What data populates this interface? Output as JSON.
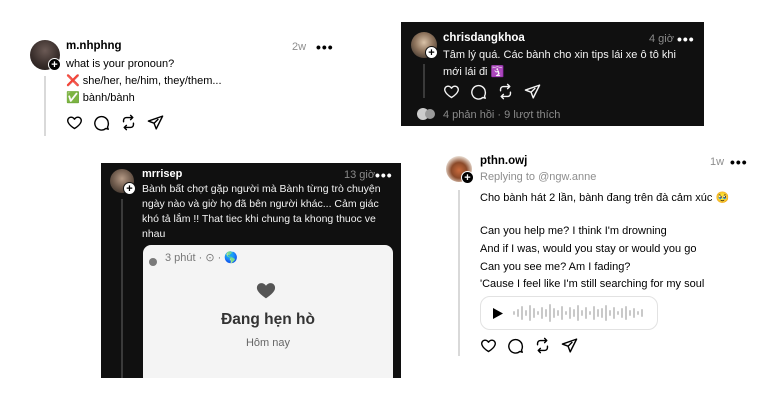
{
  "post1": {
    "username": "m.nhphng",
    "time": "2w",
    "line1": "what is your pronoun?",
    "line2": "❌ she/her, he/him, they/them...",
    "line3": "✅ bành/bành"
  },
  "post2": {
    "username": "chrisdangkhoa",
    "time": "4 giờ",
    "text": "Tâm lý quá. Các bành cho xin tips lái xe ô tô khi mới lái đi 🛐",
    "stats": "4 phản hồi · 9 lượt thích"
  },
  "post3": {
    "username": "mrrisep",
    "time": "13 giờ",
    "text": "Bành bất chợt gặp người mà Bành từng trò chuyện ngày nào và giờ họ đã bên người khác... Cảm giác khó tả lắm !! That tiec khi chung ta khong thuoc ve nhau",
    "embed_time": "3 phút · ⊙ · 🌎",
    "embed_title": "Đang hẹn hò",
    "embed_sub": "Hôm nay"
  },
  "post4": {
    "username": "pthn.owj",
    "time": "1w",
    "reply_to": "Replying to @ngw.anne",
    "line1": "Cho bành hát 2 lần, bành đang trên đà cảm xúc 🥹",
    "lyric1": "Can you help me? I think I'm drowning",
    "lyric2": "And if I was, would you stay or would you go",
    "lyric3": "Can you see me? Am I fading?",
    "lyric4": "'Cause I feel like I'm still searching for my soul"
  },
  "more_label": "•••"
}
